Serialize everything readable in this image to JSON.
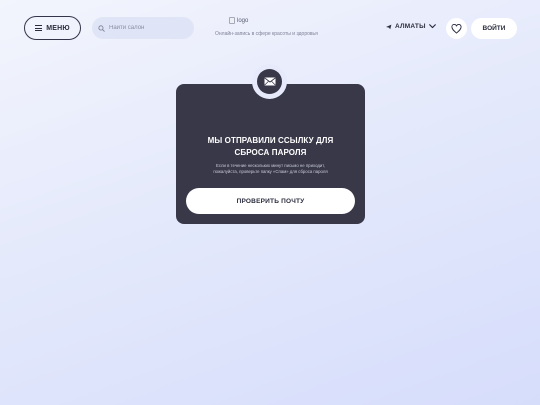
{
  "header": {
    "menu_label": "МЕНЮ",
    "search_placeholder": "Найти салон",
    "logo_alt": "logo",
    "tagline": "Онлайн-запись в сфере красоты и здоровья",
    "city": "АЛМАТЫ",
    "login_label": "ВОЙТИ"
  },
  "icons": {
    "menu": "burger-icon",
    "search": "search-icon",
    "location": "location-arrow-icon",
    "city_dropdown": "chevron-down-icon",
    "favorites": "heart-icon",
    "mail": "envelope-icon"
  },
  "card": {
    "title_line1": "МЫ ОТПРАВИЛИ ССЫЛКУ ДЛЯ",
    "title_line2": "СБРОСА ПАРОЛЯ",
    "text_line1": "Если в течение нескольких минут письмо не приходит,",
    "text_line2": "пожалуйста, проверьте папку «Спам» для сброса пароля",
    "button_label": "ПРОВЕРИТЬ ПОЧТУ"
  },
  "colors": {
    "card_bg": "#383849",
    "button_bg": "#ffffff",
    "text_dark": "#2b2c3d",
    "background_start": "#f3f5fd",
    "background_end": "#d6ddfb"
  }
}
